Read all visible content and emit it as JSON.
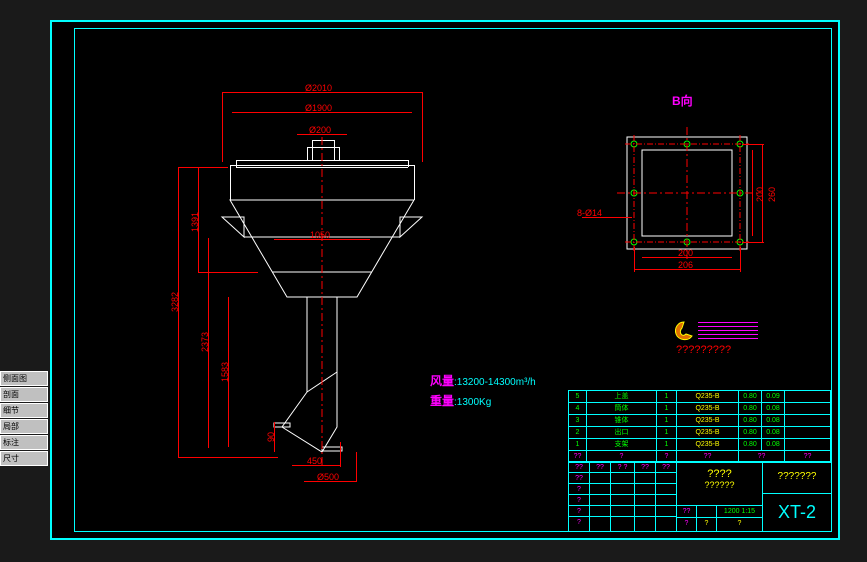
{
  "left_toolbar": [
    "侧面图",
    "剖面",
    "细节",
    "局部",
    "标注",
    "尺寸"
  ],
  "main_view": {
    "dims": {
      "d2010": "Ø2010",
      "d1900": "Ø1900",
      "d200": "Ø200",
      "d500": "Ø500",
      "h3282": "3282",
      "h1391": "1391",
      "h2373": "2373",
      "h1583": "1583",
      "h90": "90",
      "w450": "450",
      "w1050": "1050"
    }
  },
  "detail_view": {
    "label": "B向",
    "dims": {
      "w206": "206",
      "w200_inner": "200",
      "h260": "260",
      "h200": "200",
      "holes": "8-Ø14"
    }
  },
  "specs": {
    "flow_label": "风量",
    "flow_value": ":13200-14300m³/h",
    "weight_label": "重量",
    "weight_value": ":1300Kg"
  },
  "logo_text": "?????????",
  "parts_list": [
    {
      "no": "5",
      "name": "上盖",
      "qty": "1",
      "mat": "Q235-B",
      "w1": "0.80",
      "w2": "0.09"
    },
    {
      "no": "4",
      "name": "筒体",
      "qty": "1",
      "mat": "Q235-B",
      "w1": "0.80",
      "w2": "0.08"
    },
    {
      "no": "3",
      "name": "锥体",
      "qty": "1",
      "mat": "Q235-B",
      "w1": "0.80",
      "w2": "0.08"
    },
    {
      "no": "2",
      "name": "出口",
      "qty": "1",
      "mat": "Q235-B",
      "w1": "0.80",
      "w2": "0.08"
    },
    {
      "no": "1",
      "name": "支架",
      "qty": "1",
      "mat": "Q235-B",
      "w1": "0.80",
      "w2": "0.08"
    }
  ],
  "parts_header": {
    "c1": "??",
    "c2": "?",
    "c3": "?",
    "c4": "??",
    "c5": "??",
    "c6": "??"
  },
  "title_block": {
    "title1": "????",
    "title2": "??????",
    "company": "???????",
    "scale": "1200 1:15",
    "drawing_no": "XT-2",
    "header_row": [
      "??",
      "??",
      "? ?",
      "??",
      "??"
    ],
    "sub_row": [
      "??",
      "?",
      "?",
      "?",
      "?"
    ]
  }
}
